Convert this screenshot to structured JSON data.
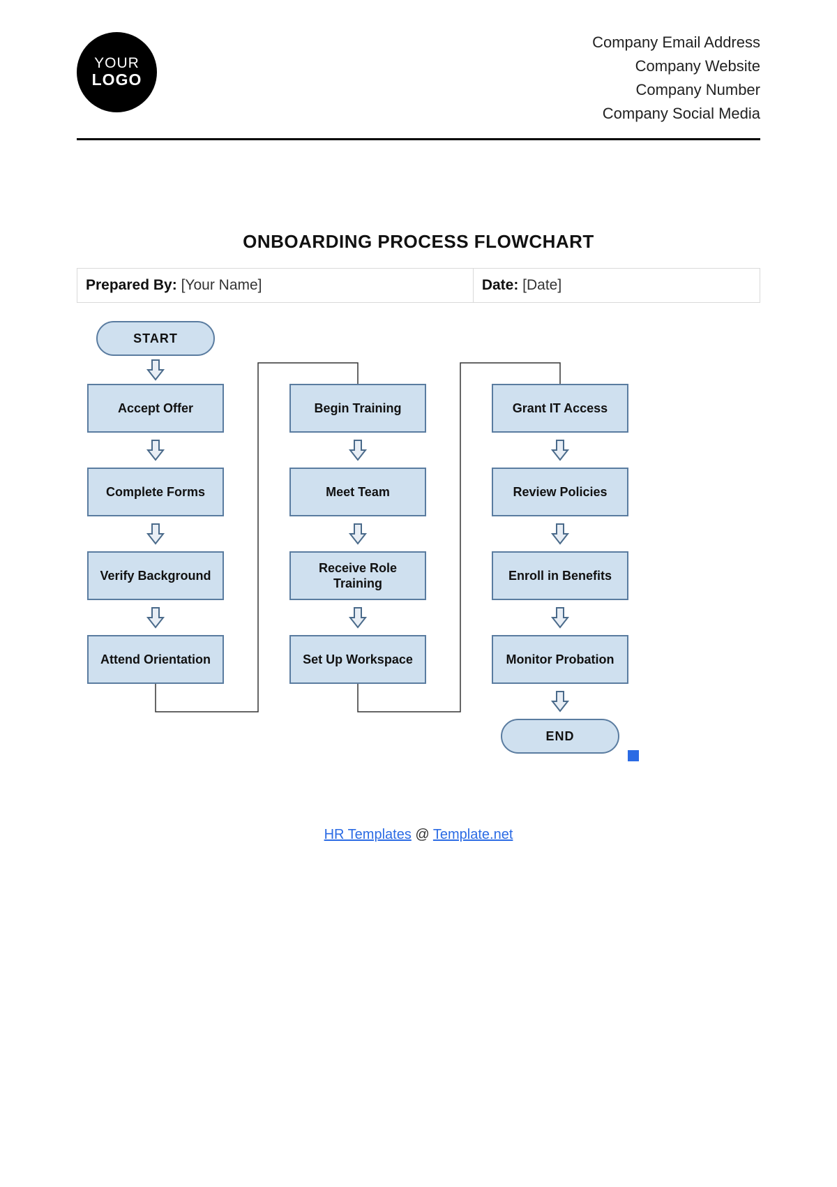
{
  "header": {
    "logo_line1": "YOUR",
    "logo_line2": "LOGO",
    "company_info": [
      "Company Email Address",
      "Company Website",
      "Company Number",
      "Company Social Media"
    ]
  },
  "title": "ONBOARDING PROCESS FLOWCHART",
  "meta": {
    "prepared_by_label": "Prepared By:",
    "prepared_by_value": "[Your Name]",
    "date_label": "Date:",
    "date_value": "[Date]"
  },
  "flow": {
    "start": "START",
    "end": "END",
    "col1": [
      "Accept Offer",
      "Complete Forms",
      "Verify Background",
      "Attend Orientation"
    ],
    "col2": [
      "Begin Training",
      "Meet Team",
      "Receive Role Training",
      "Set Up Workspace"
    ],
    "col3": [
      "Grant IT Access",
      "Review Policies",
      "Enroll in Benefits",
      "Monitor Probation"
    ]
  },
  "footer": {
    "link1_text": "HR Templates",
    "at": " @ ",
    "link2_text": "Template.net"
  },
  "colors": {
    "node_fill": "#cfe0ef",
    "node_stroke": "#5a7ca0",
    "link": "#2b6be4"
  }
}
